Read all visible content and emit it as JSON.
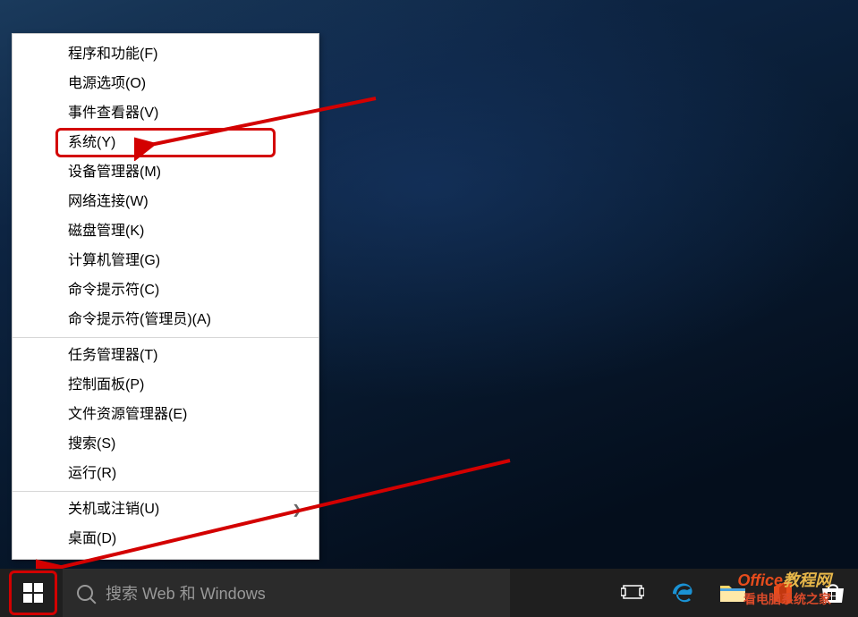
{
  "menu": {
    "items_group1": [
      {
        "label": "程序和功能(F)"
      },
      {
        "label": "电源选项(O)"
      },
      {
        "label": "事件查看器(V)"
      },
      {
        "label": "系统(Y)",
        "highlighted": true
      },
      {
        "label": "设备管理器(M)"
      },
      {
        "label": "网络连接(W)"
      },
      {
        "label": "磁盘管理(K)"
      },
      {
        "label": "计算机管理(G)"
      },
      {
        "label": "命令提示符(C)"
      },
      {
        "label": "命令提示符(管理员)(A)"
      }
    ],
    "items_group2": [
      {
        "label": "任务管理器(T)"
      },
      {
        "label": "控制面板(P)"
      },
      {
        "label": "文件资源管理器(E)"
      },
      {
        "label": "搜索(S)"
      },
      {
        "label": "运行(R)"
      }
    ],
    "items_group3": [
      {
        "label": "关机或注销(U)",
        "has_submenu": true
      },
      {
        "label": "桌面(D)"
      }
    ]
  },
  "taskbar": {
    "search_placeholder": "搜索 Web 和 Windows"
  },
  "watermark": {
    "line1_a": "Office",
    "line1_b": "教程网",
    "line2": "看电脑系统之家"
  },
  "colors": {
    "highlight_border": "#d30000",
    "arrow": "#d30000",
    "taskbar": "#1f1f1f"
  }
}
